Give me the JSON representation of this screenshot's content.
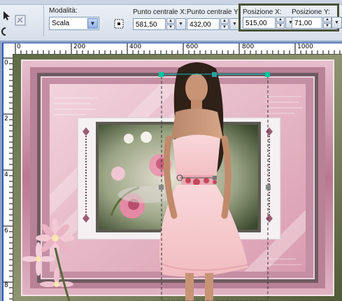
{
  "toolbar": {
    "modalita_label": "Modalità:",
    "modalita_value": "Scala",
    "punto_x_label": "Punto centrale X:",
    "punto_x_value": "581,50",
    "punto_y_label": "Punto centrale Y:",
    "punto_y_value": "432,00",
    "pos_x_label": "Posizione X:",
    "pos_x_value": "515,00",
    "pos_y_label": "Posizione Y:",
    "pos_y_value": "71,00"
  },
  "ruler": {
    "top_ticks": [
      "0",
      "200",
      "400",
      "600",
      "800",
      "1000"
    ],
    "left_ticks": [
      "0",
      "2",
      "4",
      "6",
      "8"
    ]
  },
  "colors": {
    "highlight_border": "#4a5138",
    "selection_handle": "#00c8a0",
    "frame_pink": "#c98aa0"
  }
}
